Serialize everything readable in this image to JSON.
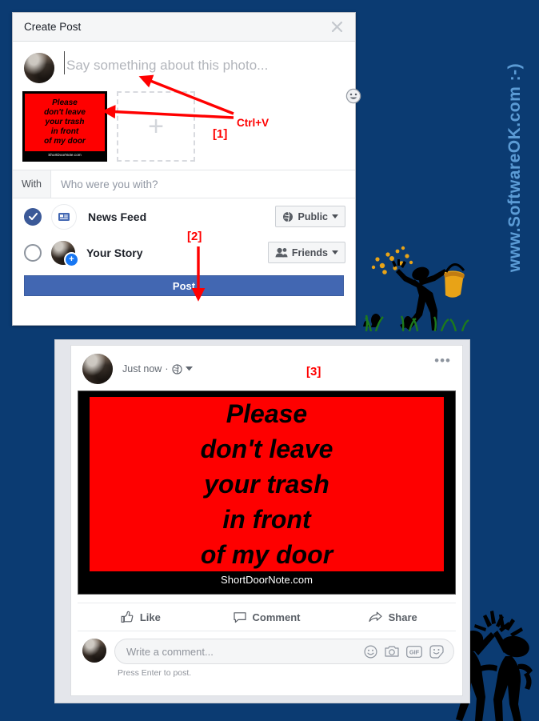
{
  "watermark": {
    "text": "www.SoftwareOK.com  :-)",
    "color": "#5b9bd5"
  },
  "background": {
    "color": "#0b3b72"
  },
  "dialog": {
    "title": "Create Post",
    "close_icon": "close-icon",
    "composer": {
      "placeholder": "Say something about this photo...",
      "emoji_icon": "emoji-smiley-icon"
    },
    "media": {
      "thumbnail_alt": "pasted-photo-thumbnail",
      "add_photo_label": "+"
    },
    "with": {
      "label": "With",
      "placeholder": "Who were you with?"
    },
    "audience_rows": [
      {
        "label": "News Feed",
        "selected": true,
        "icon": "news-feed-icon",
        "privacy": "Public",
        "privacy_icon": "globe-icon"
      },
      {
        "label": "Your Story",
        "selected": false,
        "icon": "story-avatar-icon",
        "privacy": "Friends",
        "privacy_icon": "friends-icon"
      }
    ],
    "post_button": "Post"
  },
  "annotations": {
    "ctrl_v": "Ctrl+V",
    "step1": "[1]",
    "step2": "[2]",
    "step3": "[3]"
  },
  "feed": {
    "post": {
      "timestamp": "Just now",
      "separator": "·",
      "privacy_icon": "globe-icon",
      "more_icon": "more-options-icon",
      "more_label": "•••"
    },
    "image": {
      "lines": [
        "Please",
        "don't leave",
        "your trash",
        "in front",
        "of my door"
      ],
      "credit": "ShortDoorNote.com",
      "background_color": "#fe0000",
      "text_color": "#000000",
      "frame_color": "#000000"
    },
    "actions": [
      {
        "label": "Like",
        "icon": "thumbs-up-icon"
      },
      {
        "label": "Comment",
        "icon": "comment-bubble-icon"
      },
      {
        "label": "Share",
        "icon": "share-arrow-icon"
      }
    ],
    "comment": {
      "placeholder": "Write a comment...",
      "hint": "Press Enter to post.",
      "icons": [
        "emoji-smiley-icon",
        "camera-icon",
        "gif-icon",
        "sticker-icon"
      ]
    }
  }
}
